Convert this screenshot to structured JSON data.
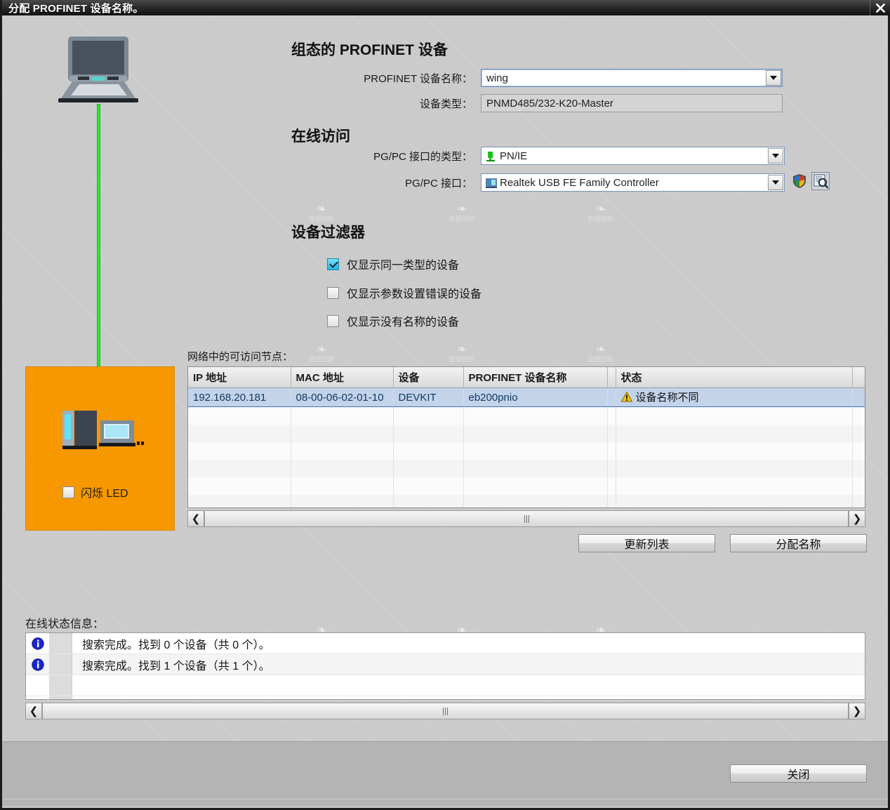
{
  "window": {
    "title": "分配 PROFINET 设备名称。",
    "close_icon": "close-x-icon"
  },
  "configured_section": {
    "heading": "组态的 PROFINET 设备",
    "device_name_label": "PROFINET 设备名称：",
    "device_name_value": "wing",
    "device_type_label": "设备类型：",
    "device_type_value": "PNMD485/232-K20-Master"
  },
  "online_access": {
    "heading": "在线访问",
    "pgpc_type_label": "PG/PC 接口的类型：",
    "pgpc_type_value": "PN/IE",
    "pgpc_iface_label": "PG/PC 接口：",
    "pgpc_iface_value": "Realtek USB FE Family Controller",
    "shield_icon": "shield-icon",
    "browse_icon": "browse-search-icon"
  },
  "device_filter": {
    "heading": "设备过滤器",
    "items": [
      {
        "label": "仅显示同一类型的设备",
        "checked": true
      },
      {
        "label": "仅显示参数设置错误的设备",
        "checked": false
      },
      {
        "label": "仅显示没有名称的设备",
        "checked": false
      }
    ]
  },
  "device_panel": {
    "flash_led_label": "闪烁 LED",
    "flash_led_checked": false,
    "pg_icon": "laptop-pg-icon",
    "device_icon": "plc-device-icon",
    "cable_color": "#2ce62c",
    "panel_color": "#f79800"
  },
  "nodes_table": {
    "caption": "网络中的可访问节点：",
    "columns": [
      "IP 地址",
      "MAC 地址",
      "设备",
      "PROFINET 设备名称",
      "",
      "状态"
    ],
    "rows": [
      {
        "ip": "192.168.20.181",
        "mac": "08-00-06-02-01-10",
        "device": "DEVKIT",
        "profinet_name": "eb200pnio",
        "status": "设备名称不同",
        "status_icon": "warning-icon",
        "selected": true
      }
    ],
    "empty_row_count": 6,
    "scroll_left_icon": "chevron-left-icon",
    "scroll_right_icon": "chevron-right-icon"
  },
  "actions": {
    "refresh_label": "更新列表",
    "assign_label": "分配名称",
    "close_label": "关闭"
  },
  "status_log": {
    "label": "在线状态信息：",
    "entries": [
      {
        "icon": "info-icon",
        "message": "搜索完成。找到 0 个设备（共 0 个）。"
      },
      {
        "icon": "info-icon",
        "message": "搜索完成。找到 1 个设备（共 1 个）。"
      }
    ],
    "scroll_left_icon": "chevron-left-icon",
    "scroll_right_icon": "chevron-right-icon"
  },
  "watermark": {
    "glyph": "❧",
    "text": "数据创新"
  }
}
